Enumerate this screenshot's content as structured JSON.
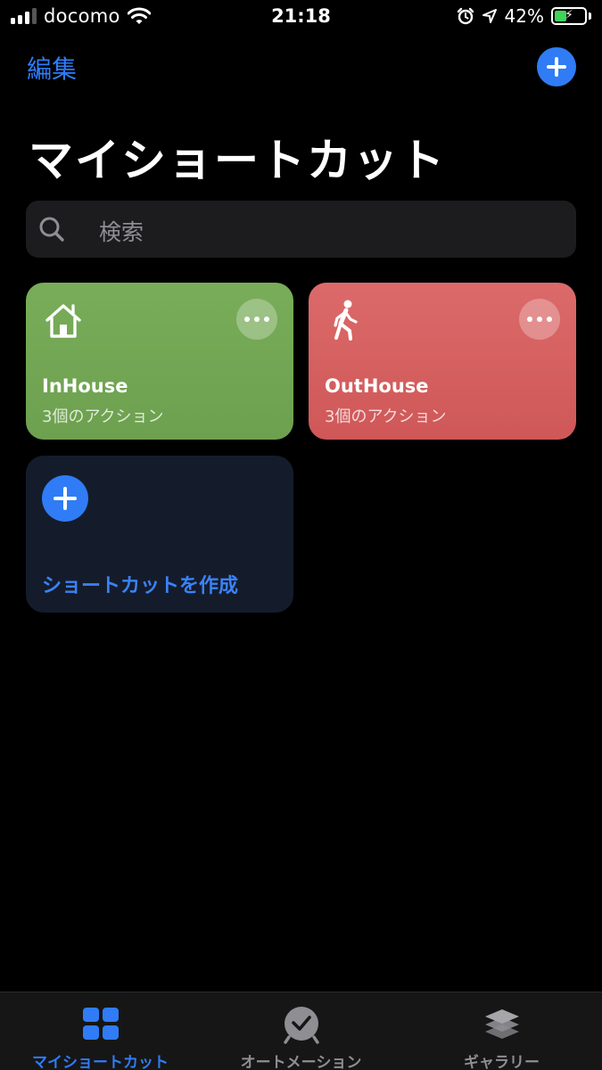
{
  "status_bar": {
    "carrier": "docomo",
    "time": "21:18",
    "battery_percent": "42%",
    "battery_level": 0.42
  },
  "nav": {
    "edit_label": "編集"
  },
  "page": {
    "title": "マイショートカット"
  },
  "search": {
    "placeholder": "検索"
  },
  "shortcuts": [
    {
      "title": "InHouse",
      "subtitle": "3個のアクション",
      "icon": "house-icon",
      "color": "#74a754"
    },
    {
      "title": "OutHouse",
      "subtitle": "3個のアクション",
      "icon": "walking-person-icon",
      "color": "#d55f5f"
    }
  ],
  "create_card": {
    "label": "ショートカットを作成"
  },
  "tabs": [
    {
      "label": "マイショートカット",
      "icon": "grid-icon",
      "active": true
    },
    {
      "label": "オートメーション",
      "icon": "clock-check-icon",
      "active": false
    },
    {
      "label": "ギャラリー",
      "icon": "layers-icon",
      "active": false
    }
  ],
  "colors": {
    "accent": "#2f7cf6",
    "background": "#000000"
  }
}
